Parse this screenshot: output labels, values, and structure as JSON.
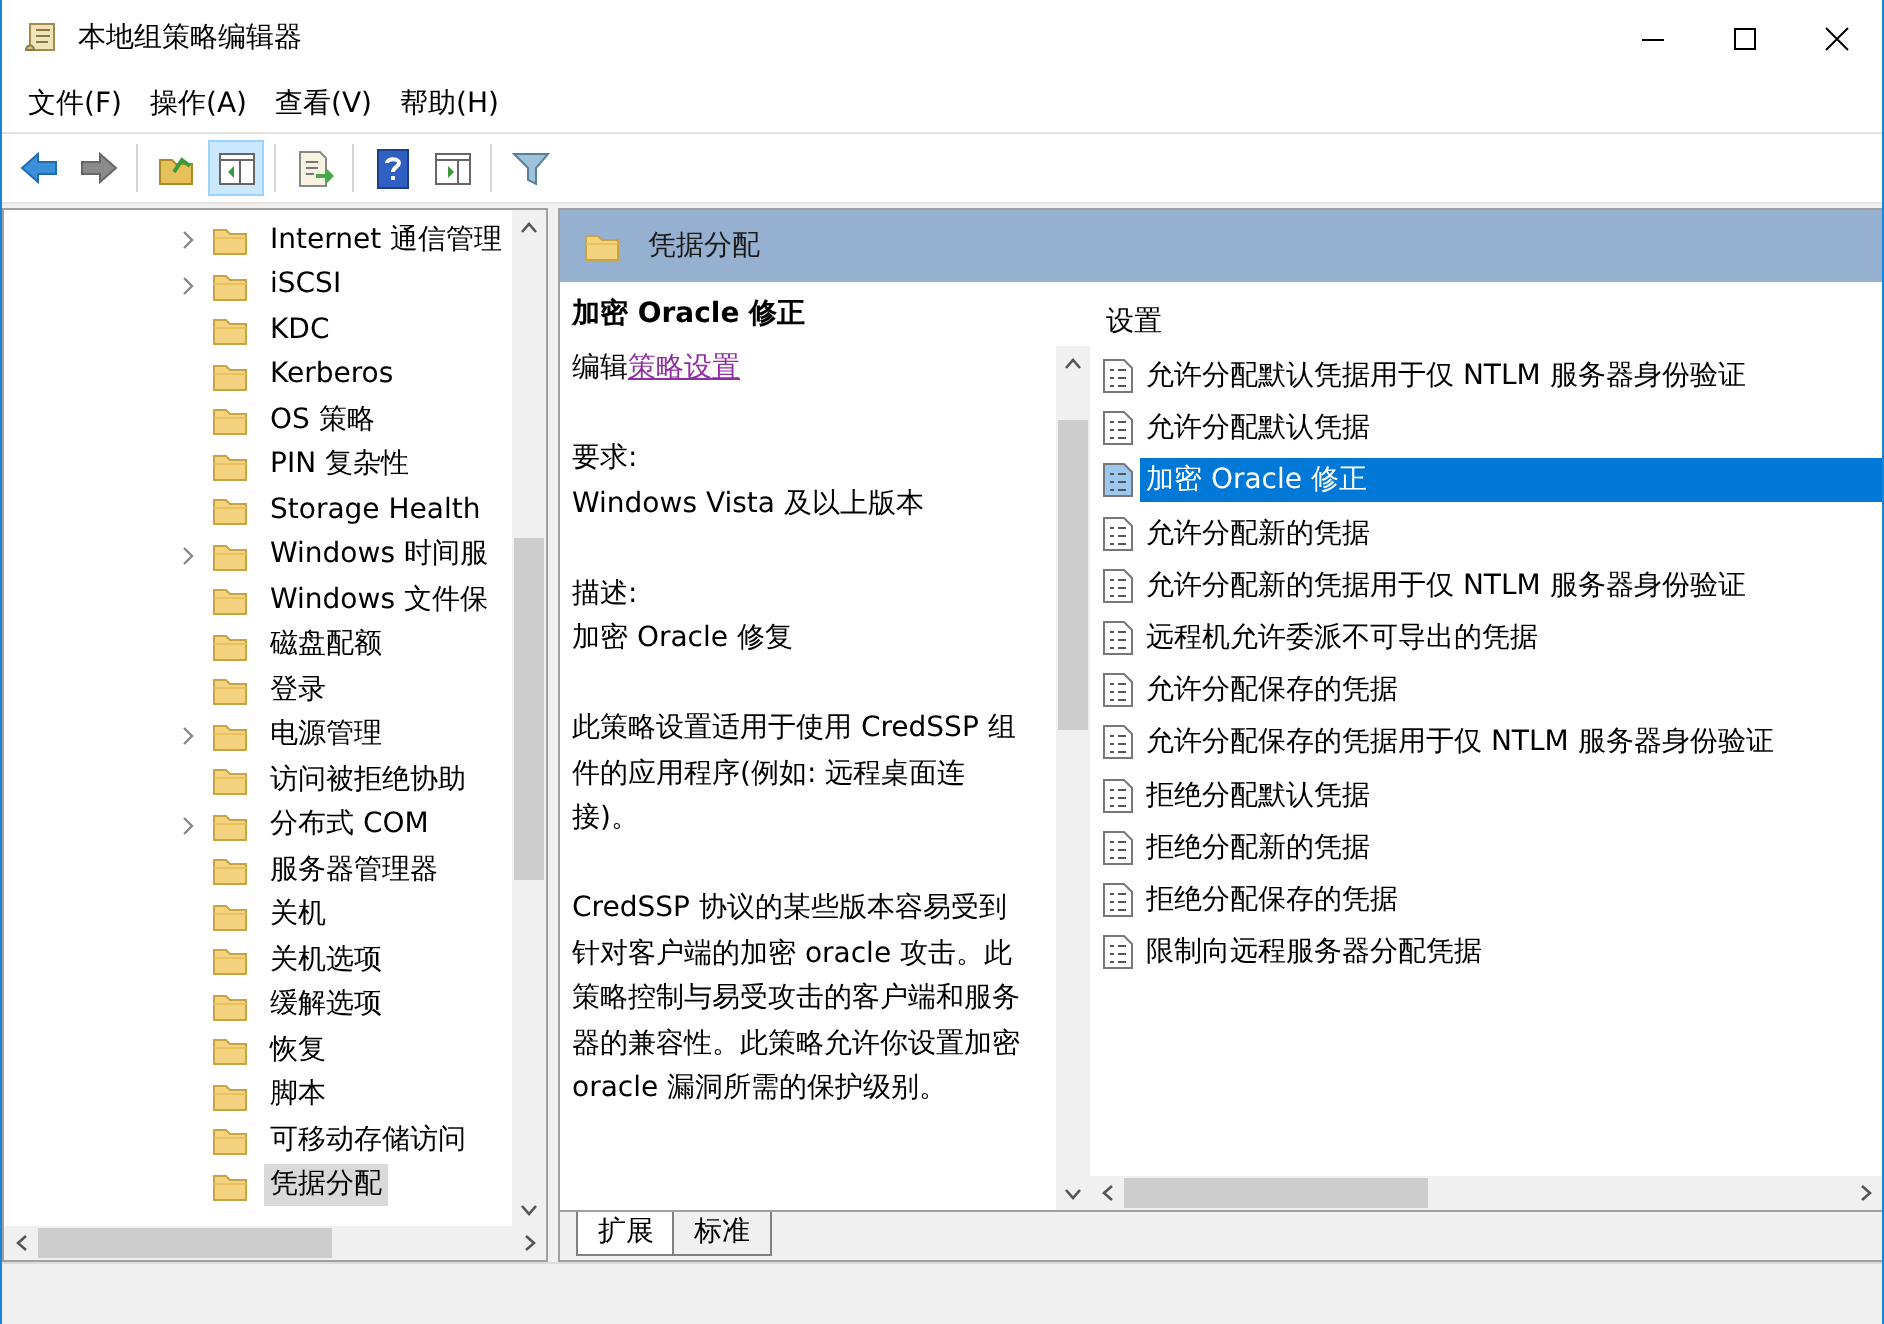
{
  "window": {
    "title": "本地组策略编辑器"
  },
  "menu": [
    "文件(F)",
    "操作(A)",
    "查看(V)",
    "帮助(H)"
  ],
  "toolbar": [
    [
      {
        "kind": "back",
        "pressed": false
      },
      {
        "kind": "forward",
        "pressed": false
      }
    ],
    [
      {
        "kind": "up",
        "pressed": false
      },
      {
        "kind": "tree",
        "pressed": true
      }
    ],
    [
      {
        "kind": "export",
        "pressed": false
      }
    ],
    [
      {
        "kind": "help",
        "pressed": false
      },
      {
        "kind": "pane",
        "pressed": false
      }
    ],
    [
      {
        "kind": "filter",
        "pressed": false
      }
    ]
  ],
  "tree": [
    {
      "label": "Internet 通信管理",
      "expandable": true,
      "selected": false
    },
    {
      "label": "iSCSI",
      "expandable": true,
      "selected": false
    },
    {
      "label": "KDC",
      "expandable": false,
      "selected": false
    },
    {
      "label": "Kerberos",
      "expandable": false,
      "selected": false
    },
    {
      "label": "OS 策略",
      "expandable": false,
      "selected": false
    },
    {
      "label": "PIN 复杂性",
      "expandable": false,
      "selected": false
    },
    {
      "label": "Storage Health",
      "expandable": false,
      "selected": false
    },
    {
      "label": "Windows 时间服",
      "expandable": true,
      "selected": false
    },
    {
      "label": "Windows 文件保",
      "expandable": false,
      "selected": false
    },
    {
      "label": "磁盘配额",
      "expandable": false,
      "selected": false
    },
    {
      "label": "登录",
      "expandable": false,
      "selected": false
    },
    {
      "label": "电源管理",
      "expandable": true,
      "selected": false
    },
    {
      "label": "访问被拒绝协助",
      "expandable": false,
      "selected": false
    },
    {
      "label": "分布式 COM",
      "expandable": true,
      "selected": false
    },
    {
      "label": "服务器管理器",
      "expandable": false,
      "selected": false
    },
    {
      "label": "关机",
      "expandable": false,
      "selected": false
    },
    {
      "label": "关机选项",
      "expandable": false,
      "selected": false
    },
    {
      "label": "缓解选项",
      "expandable": false,
      "selected": false
    },
    {
      "label": "恢复",
      "expandable": false,
      "selected": false
    },
    {
      "label": "脚本",
      "expandable": false,
      "selected": false
    },
    {
      "label": "可移动存储访问",
      "expandable": false,
      "selected": false
    },
    {
      "label": "凭据分配",
      "expandable": false,
      "selected": true
    }
  ],
  "header": {
    "title": "凭据分配"
  },
  "description": {
    "title": "加密 Oracle 修正",
    "edit_prefix": "编辑",
    "edit_link": "策略设置",
    "paragraphs": [
      [
        "要求:",
        "Windows Vista 及以上版本"
      ],
      [
        "描述:",
        "加密 Oracle 修复"
      ],
      [
        "此策略设置适用于使用 CredSSP 组件的应用程序(例如: 远程桌面连接)。"
      ],
      [
        "CredSSP 协议的某些版本容易受到针对客户端的加密 oracle 攻击。此策略控制与易受攻击的客户端和服务器的兼容性。此策略允许你设置加密 oracle 漏洞所需的保护级别。"
      ]
    ]
  },
  "settings": {
    "heading": "设置",
    "items": [
      {
        "label": "允许分配默认凭据用于仅 NTLM 服务器身份验证",
        "selected": false
      },
      {
        "label": "允许分配默认凭据",
        "selected": false
      },
      {
        "label": "加密 Oracle 修正",
        "selected": true
      },
      {
        "label": "允许分配新的凭据",
        "selected": false
      },
      {
        "label": "允许分配新的凭据用于仅 NTLM 服务器身份验证",
        "selected": false
      },
      {
        "label": "远程机允许委派不可导出的凭据",
        "selected": false
      },
      {
        "label": "允许分配保存的凭据",
        "selected": false
      },
      {
        "label": "允许分配保存的凭据用于仅 NTLM 服务器身份验证",
        "selected": false
      },
      {
        "label": "拒绝分配默认凭据",
        "selected": false
      },
      {
        "label": "拒绝分配新的凭据",
        "selected": false
      },
      {
        "label": "拒绝分配保存的凭据",
        "selected": false
      },
      {
        "label": "限制向远程服务器分配凭据",
        "selected": false
      }
    ]
  },
  "tabs": [
    {
      "label": "扩展",
      "selected": true
    },
    {
      "label": "标准",
      "selected": false
    }
  ]
}
